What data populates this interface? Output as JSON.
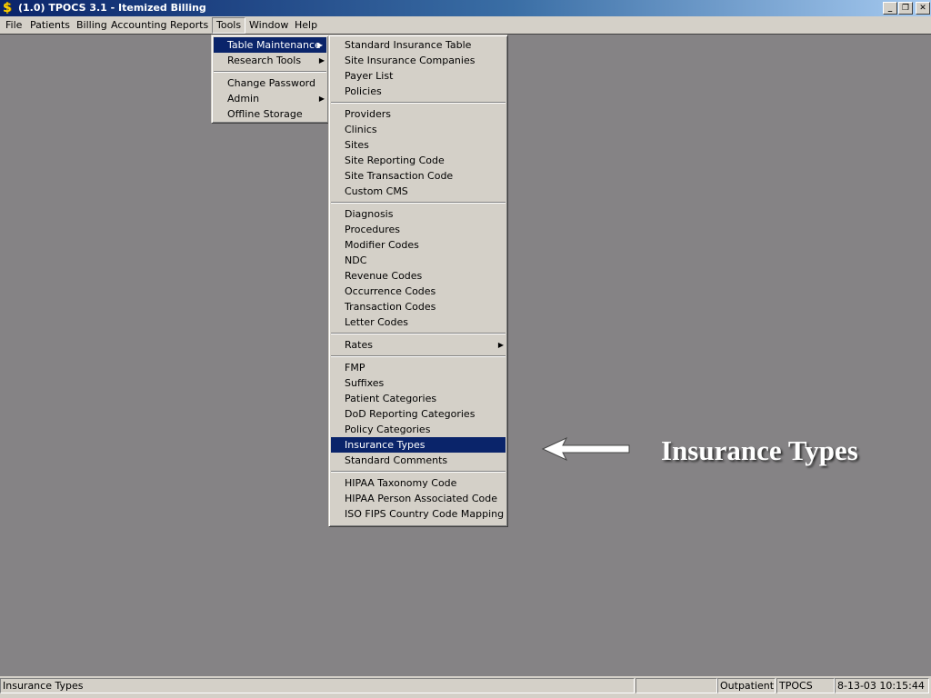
{
  "window": {
    "title": "(1.0) TPOCS 3.1 - Itemized Billing",
    "icon": "dollar-icon",
    "controls": {
      "minimize": "_",
      "restore": "❐",
      "close": "✕"
    }
  },
  "menubar": {
    "items": [
      "File",
      "Patients",
      "Billing",
      "Accounting",
      "Reports",
      "Tools",
      "Window",
      "Help"
    ],
    "active": "Tools"
  },
  "tools_menu": {
    "items": [
      {
        "label": "Table Maintenance",
        "submenu": true,
        "highlighted": true
      },
      {
        "label": "Research Tools",
        "submenu": true
      },
      {
        "label": "Change Password"
      },
      {
        "label": "Admin",
        "submenu": true
      },
      {
        "label": "Offline Storage"
      }
    ]
  },
  "table_maintenance_menu": {
    "groups": [
      [
        "Standard Insurance Table",
        "Site Insurance Companies",
        "Payer List",
        "Policies"
      ],
      [
        "Providers",
        "Clinics",
        "Sites",
        "Site Reporting Code",
        "Site Transaction Code",
        "Custom CMS"
      ],
      [
        "Diagnosis",
        "Procedures",
        "Modifier Codes",
        "NDC",
        "Revenue Codes",
        "Occurrence Codes",
        "Transaction Codes",
        "Letter Codes"
      ],
      [
        "Rates"
      ],
      [
        "FMP",
        "Suffixes",
        "Patient Categories",
        "DoD Reporting Categories",
        "Policy Categories",
        "Insurance Types",
        "Standard Comments"
      ],
      [
        "HIPAA Taxonomy Code",
        "HIPAA Person Associated Code",
        "ISO FIPS Country Code Mapping"
      ]
    ],
    "highlighted": "Insurance Types",
    "submenu_items": [
      "Rates"
    ]
  },
  "annotation": {
    "label": "Insurance Types",
    "icon": "left-arrow-icon"
  },
  "statusbar": {
    "message": "Insurance Types",
    "blank": "",
    "mode": "Outpatient",
    "system": "TPOCS",
    "datetime": "8-13-03 10:15:44"
  },
  "colors": {
    "titlebar_start": "#0a246a",
    "highlight": "#0a246a",
    "workspace": "#858385",
    "face": "#d4d0c8"
  }
}
